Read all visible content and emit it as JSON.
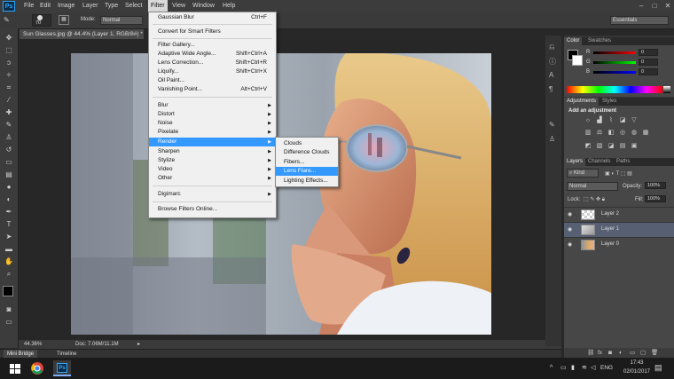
{
  "app": {
    "logo": "Ps"
  },
  "menubar": {
    "items": [
      "File",
      "Edit",
      "Image",
      "Layer",
      "Type",
      "Select",
      "Filter",
      "View",
      "Window",
      "Help"
    ],
    "active": "Filter",
    "minimize": "–",
    "maximize": "□",
    "close": "✕"
  },
  "options": {
    "brush_size": "70",
    "mode_label": "Mode:",
    "mode_value": "Normal",
    "workspace": "Essentials"
  },
  "document": {
    "tab_title": "Sun Glasses.jpg @ 44.4% (Layer 1, RGB/8#) *",
    "tab_close": "×",
    "zoom": "44.36%",
    "doc_info": "Doc: 7.06M/11.1M",
    "status_arrow": "▸"
  },
  "bottom_tabs": {
    "mini_bridge": "Mini Bridge",
    "timeline": "Timeline"
  },
  "filter_menu": {
    "items": [
      {
        "label": "Gaussian Blur",
        "shortcut": "Ctrl+F"
      },
      {
        "label": "Convert for Smart Filters",
        "shortcut": ""
      },
      {
        "label": "Filter Gallery...",
        "shortcut": ""
      },
      {
        "label": "Adaptive Wide Angle...",
        "shortcut": "Shift+Ctrl+A"
      },
      {
        "label": "Lens Correction...",
        "shortcut": "Shift+Ctrl+R"
      },
      {
        "label": "Liquify...",
        "shortcut": "Shift+Ctrl+X"
      },
      {
        "label": "Oil Paint...",
        "shortcut": ""
      },
      {
        "label": "Vanishing Point...",
        "shortcut": "Alt+Ctrl+V"
      },
      {
        "label": "Blur",
        "shortcut": "",
        "submenu": true
      },
      {
        "label": "Distort",
        "shortcut": "",
        "submenu": true
      },
      {
        "label": "Noise",
        "shortcut": "",
        "submenu": true
      },
      {
        "label": "Pixelate",
        "shortcut": "",
        "submenu": true
      },
      {
        "label": "Render",
        "shortcut": "",
        "submenu": true
      },
      {
        "label": "Sharpen",
        "shortcut": "",
        "submenu": true
      },
      {
        "label": "Stylize",
        "shortcut": "",
        "submenu": true
      },
      {
        "label": "Video",
        "shortcut": "",
        "submenu": true
      },
      {
        "label": "Other",
        "shortcut": "",
        "submenu": true
      },
      {
        "label": "Digimarc",
        "shortcut": "",
        "submenu": true
      },
      {
        "label": "Browse Filters Online...",
        "shortcut": ""
      }
    ],
    "highlighted": "Render",
    "submenu_arrow": "▶"
  },
  "render_menu": {
    "items": [
      "Clouds",
      "Difference Clouds",
      "Fibers...",
      "Lens Flare...",
      "Lighting Effects..."
    ],
    "highlighted": "Lens Flare..."
  },
  "color_panel": {
    "tabs": [
      "Color",
      "Swatches"
    ],
    "channels": [
      {
        "label": "R",
        "value": "0"
      },
      {
        "label": "G",
        "value": "0"
      },
      {
        "label": "B",
        "value": "0"
      }
    ]
  },
  "adjustments_panel": {
    "tabs": [
      "Adjustments",
      "Styles"
    ],
    "heading": "Add an adjustment"
  },
  "layers_panel": {
    "tabs": [
      "Layers",
      "Channels",
      "Paths"
    ],
    "kind_label": "Kind",
    "blend_mode": "Normal",
    "opacity_label": "Opacity:",
    "opacity_value": "100%",
    "lock_label": "Lock:",
    "fill_label": "Fill:",
    "fill_value": "100%",
    "layers": [
      {
        "name": "Layer 2",
        "selected": false
      },
      {
        "name": "Layer 1",
        "selected": true
      },
      {
        "name": "Layer 0",
        "selected": false
      }
    ],
    "footer_icons": [
      "link-icon",
      "fx-icon",
      "mask-icon",
      "adjustment-icon",
      "folder-icon",
      "new-layer-icon",
      "trash-icon"
    ]
  },
  "taskbar": {
    "language": "ENG",
    "time": "17:43",
    "date": "02/01/2017",
    "app_icon": "Ps"
  },
  "colors": {
    "accent_highlight": "#3399ff",
    "selected_layer": "#566072",
    "ps_blue": "#31a8ff"
  }
}
